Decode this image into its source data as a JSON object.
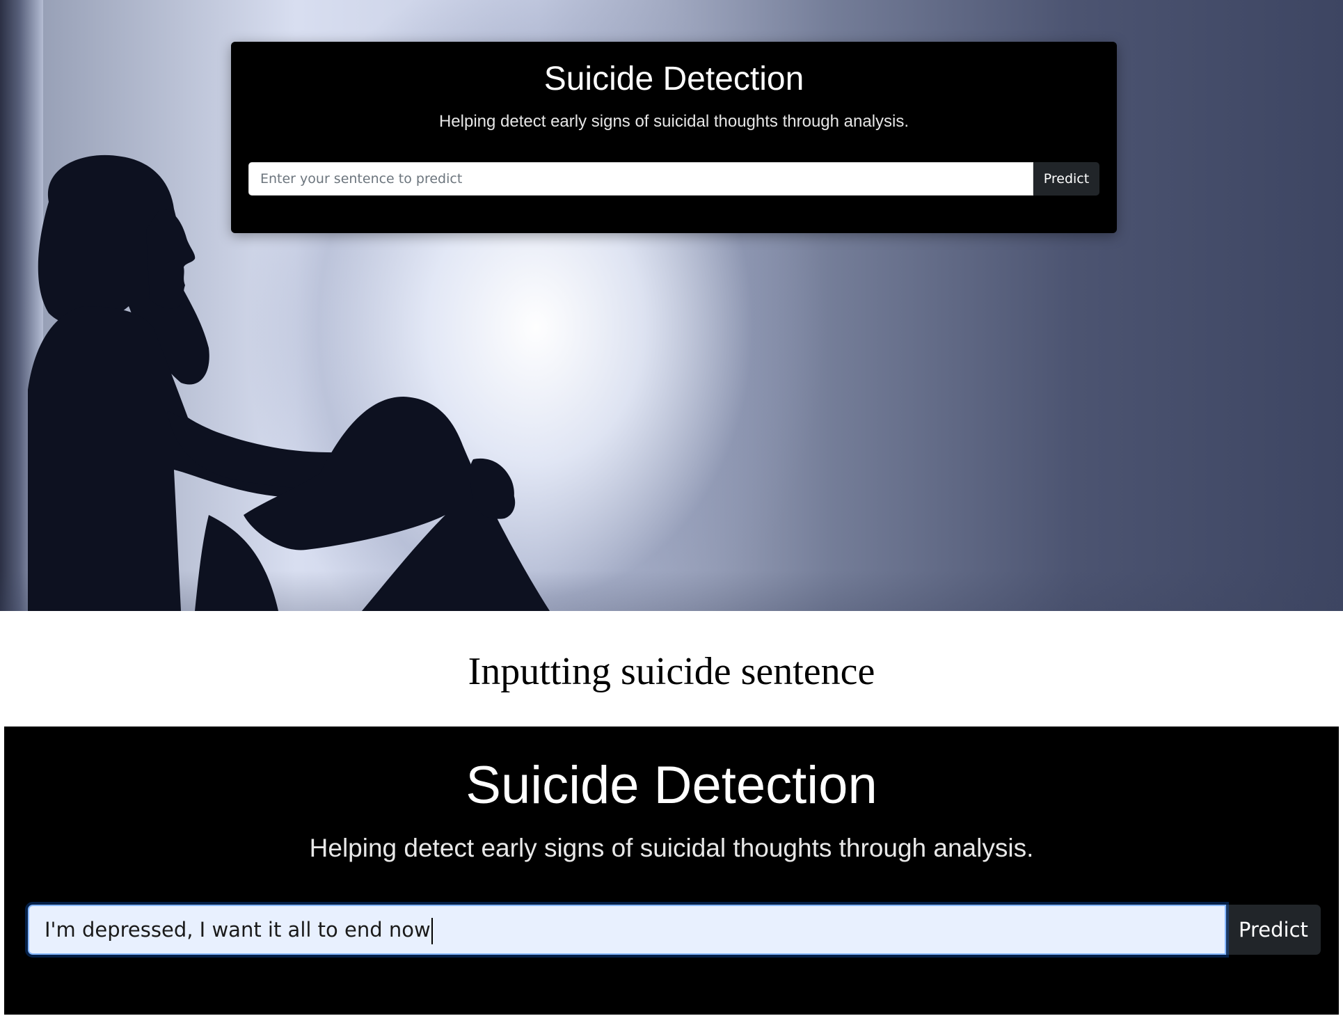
{
  "top_screenshot": {
    "app": {
      "title": "Suicide Detection",
      "subtitle": "Helping detect early signs of suicidal thoughts through analysis."
    },
    "input": {
      "value": "",
      "placeholder": "Enter your sentence to predict"
    },
    "predict_label": "Predict",
    "background_image": "silhouette-of-sad-woman-icon"
  },
  "caption": "Inputting suicide sentence",
  "bottom_screenshot": {
    "app": {
      "title": "Suicide Detection",
      "subtitle": "Helping detect early signs of suicidal thoughts through analysis."
    },
    "input": {
      "value": "I'm depressed, I want it all to end now",
      "focused": true
    },
    "predict_label": "Predict"
  },
  "colors": {
    "card_background": "#000000",
    "button_background": "#212529",
    "focused_input_background": "#e8f0fe",
    "focus_ring": "#86b7fe"
  }
}
